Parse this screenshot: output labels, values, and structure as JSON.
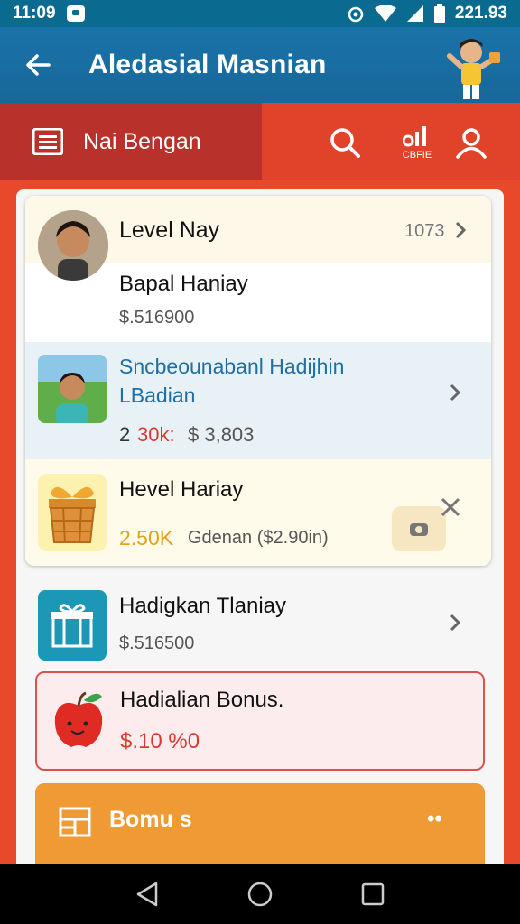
{
  "status_bar": {
    "time": "11:09",
    "battery_text": "221.93",
    "icons": [
      "notification-icon",
      "alarm-icon",
      "wifi-icon",
      "signal-icon",
      "battery-icon"
    ]
  },
  "app_bar": {
    "title": "Aledasial Masnian",
    "back_icon": "arrow-left-icon",
    "mascot": "mascot-character-icon"
  },
  "toolbar": {
    "menu_label": "Nai Bengan",
    "stats_caption": "CBFIE",
    "icons": [
      "menu-icon",
      "search-icon",
      "stats-icon",
      "profile-icon"
    ]
  },
  "items": [
    {
      "title": "Level Nay",
      "value": "1073",
      "subtitle": "Bapal Haniay",
      "amount": "$.516900"
    },
    {
      "title_line1": "Sncbeounabanl Hadijhin",
      "title_line2": "LBadian",
      "count": "2",
      "highlight": "30k:",
      "price": "$ 3,803"
    },
    {
      "title": "Hevel Hariay",
      "highlight": "2.50K",
      "detail": "Gdenan ($2.90in)"
    },
    {
      "title": "Hadigkan Tlaniay",
      "amount": "$.516500"
    }
  ],
  "bonus_card": {
    "title": "Hadialian Bonus.",
    "amount": "$.10 %0"
  },
  "bonus_button": {
    "label": "Bomu   s",
    "trailing": "••"
  },
  "colors": {
    "status_bar": "#0b6a8f",
    "app_bar": "#1a73a8",
    "toolbar": "#e0422a",
    "menu_block": "#b8312a",
    "accent_red": "#d9534a",
    "accent_orange": "#ef9a34",
    "highlight_gold": "#e3a21a",
    "teal": "#1c98b6"
  }
}
